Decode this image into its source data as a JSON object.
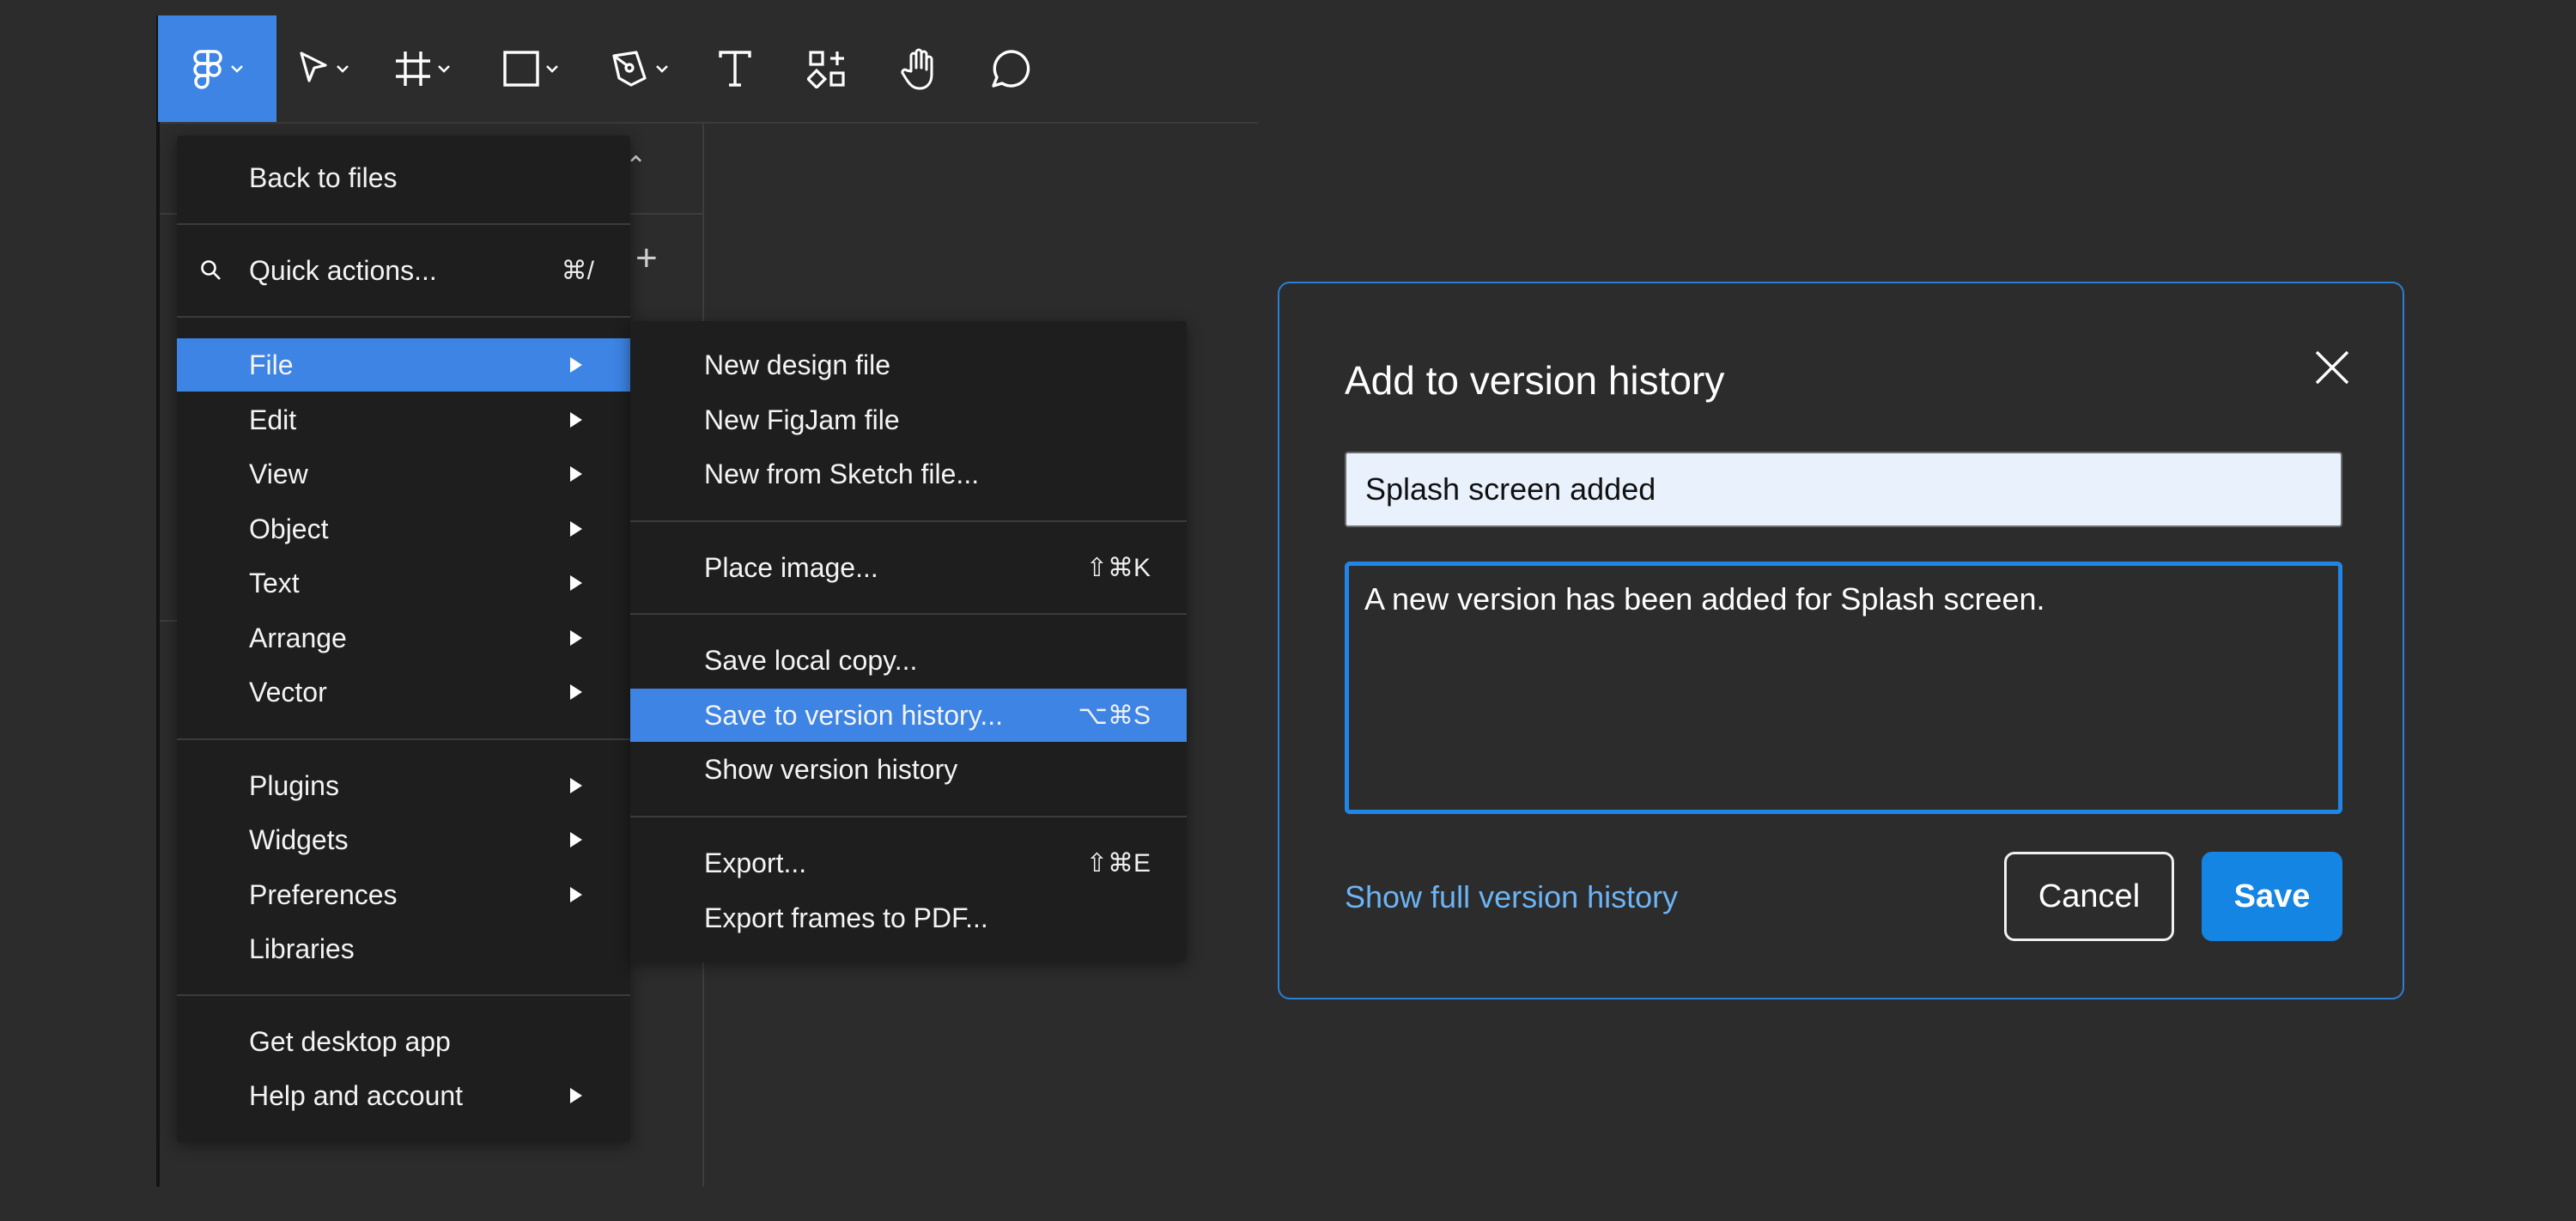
{
  "toolbar": {
    "tools": [
      {
        "name": "main-menu",
        "icon": "figma-logo-icon"
      },
      {
        "name": "move",
        "icon": "cursor-icon"
      },
      {
        "name": "frame",
        "icon": "frame-icon"
      },
      {
        "name": "shape",
        "icon": "rectangle-icon"
      },
      {
        "name": "pen",
        "icon": "pen-icon"
      },
      {
        "name": "text",
        "icon": "text-icon"
      },
      {
        "name": "resources",
        "icon": "components-icon"
      },
      {
        "name": "hand",
        "icon": "hand-icon"
      },
      {
        "name": "comment",
        "icon": "comment-icon"
      }
    ]
  },
  "menu": {
    "back_to_files": "Back to files",
    "quick_actions": "Quick actions...",
    "quick_actions_shortcut": "⌘/",
    "items": [
      "File",
      "Edit",
      "View",
      "Object",
      "Text",
      "Arrange",
      "Vector"
    ],
    "group2": [
      "Plugins",
      "Widgets",
      "Preferences",
      "Libraries"
    ],
    "get_desktop_app": "Get desktop app",
    "help_and_account": "Help and account"
  },
  "submenu": {
    "new_design_file": "New design file",
    "new_figjam_file": "New FigJam file",
    "new_from_sketch": "New from Sketch file...",
    "place_image": "Place image...",
    "place_image_shortcut": "⇧⌘K",
    "save_local_copy": "Save local copy...",
    "save_to_version_history": "Save to version history...",
    "save_to_version_history_shortcut": "⌥⌘S",
    "show_version_history": "Show version history",
    "export": "Export...",
    "export_shortcut": "⇧⌘E",
    "export_frames_pdf": "Export frames to PDF..."
  },
  "dialog": {
    "title": "Add to version history",
    "title_value": "Splash screen added",
    "description_value": "A new version has been added for Splash screen.",
    "show_full_history": "Show full version history",
    "cancel": "Cancel",
    "save": "Save"
  },
  "colors": {
    "accent": "#3d84e4",
    "primary_button": "#1585e4",
    "link": "#6cb4f5",
    "background": "#2c2c2c",
    "menu_bg": "#1e1e1e"
  }
}
